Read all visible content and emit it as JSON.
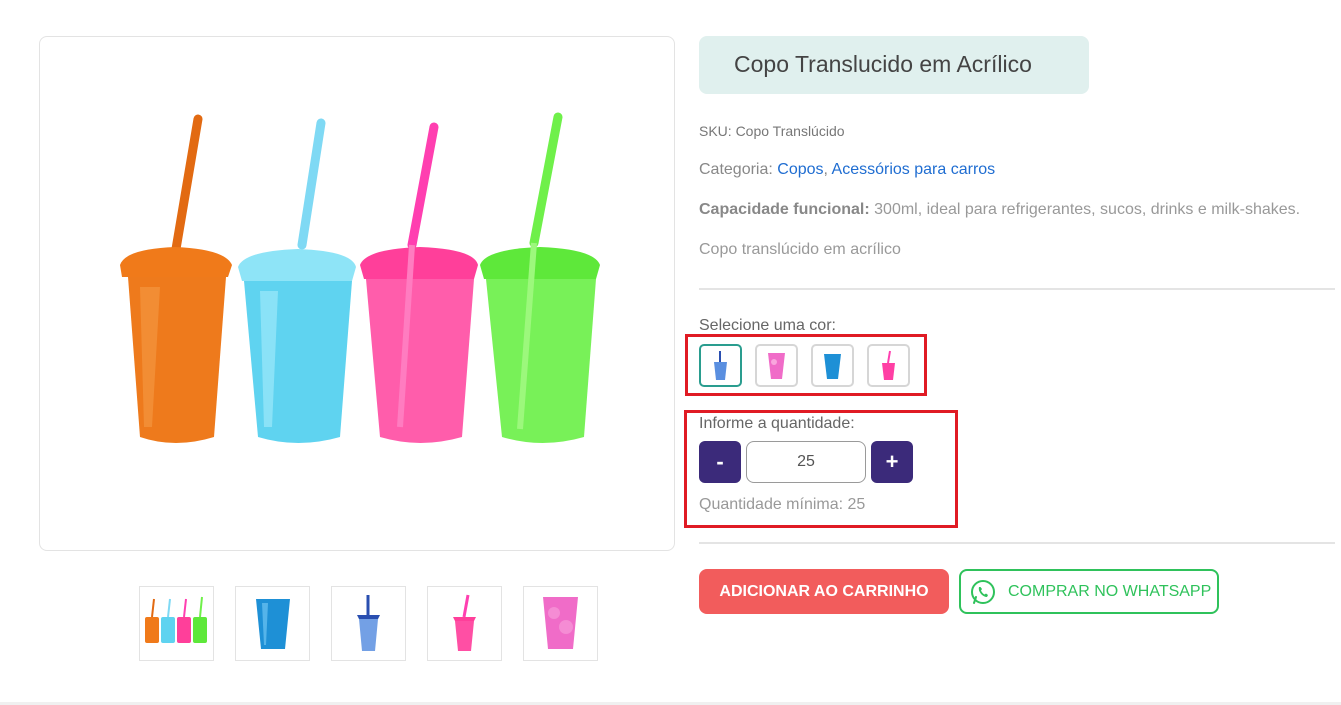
{
  "product": {
    "title": "Copo Translucido em Acrílico",
    "sku": "SKU: Copo Translúcido",
    "category_label": "Categoria:",
    "categories": [
      "Copos",
      "Acessórios para carros"
    ],
    "category_separator": ",",
    "capacity_label": "Capacidade funcional:",
    "capacity_text": "300ml, ideal para refrigerantes, sucos, drinks e milk-shakes.",
    "description": "Copo translúcido em acrílico"
  },
  "color_select": {
    "label": "Selecione uma cor:",
    "options": [
      {
        "icon": "blue-cup-with-straw-icon",
        "color": "#3a6fc4",
        "selected": true
      },
      {
        "icon": "pink-cup-icon",
        "color": "#f06cc8",
        "selected": false
      },
      {
        "icon": "blue-cup-icon",
        "color": "#1e90d6",
        "selected": false
      },
      {
        "icon": "pink-cup-with-straw-icon",
        "color": "#ff3fa4",
        "selected": false
      }
    ]
  },
  "quantity": {
    "label": "Informe a quantidade:",
    "minus": "-",
    "plus": "+",
    "value": "25",
    "minimum_text": "Quantidade mínima: 25"
  },
  "actions": {
    "add_to_cart": "ADICIONAR AO CARRINHO",
    "whatsapp": "COMPRAR NO WHATSAPP"
  },
  "colors": {
    "orange": "#f07a1a",
    "cyan": "#5fd3f0",
    "pink": "#ff3f9a",
    "green": "#5ee83a",
    "accent_purple": "#3b2a7a",
    "cart_red": "#f25c5c",
    "whatsapp_green": "#2fc25b",
    "highlight_red": "#e01b24"
  },
  "thumbnails": [
    {
      "icon": "four-cups-thumbnail-icon"
    },
    {
      "icon": "blue-cup-thumbnail-icon"
    },
    {
      "icon": "blue-cup-straw-thumbnail-icon"
    },
    {
      "icon": "pink-cup-straw-thumbnail-icon"
    },
    {
      "icon": "pink-cup-thumbnail-icon"
    }
  ]
}
